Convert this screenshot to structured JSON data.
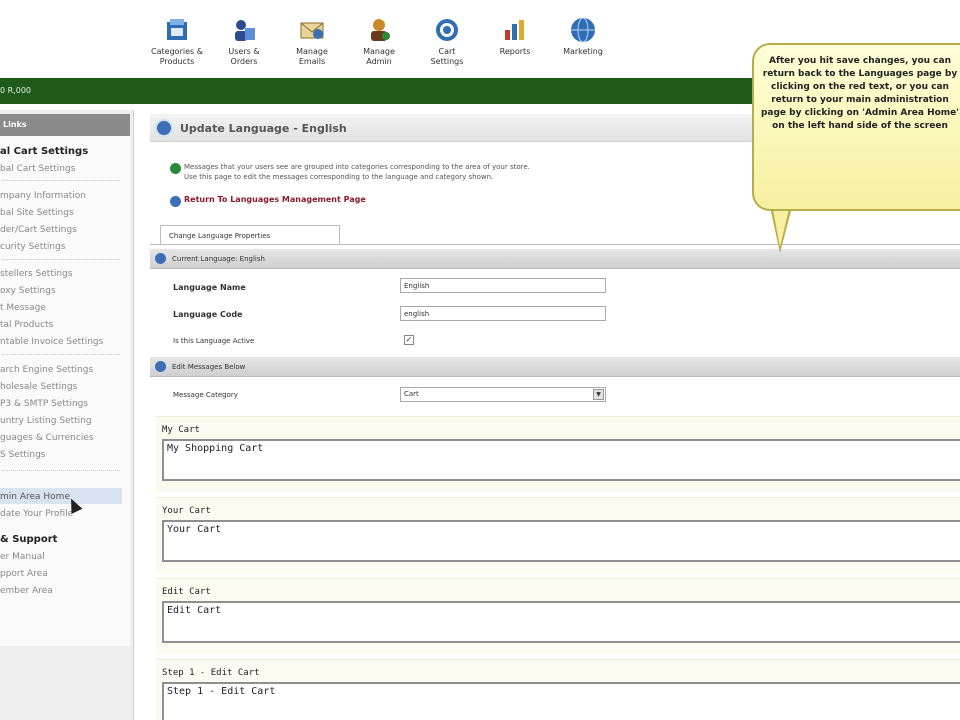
{
  "topnav": {
    "items": [
      {
        "label": "Categories &\nProducts",
        "icon": "categories-products-icon"
      },
      {
        "label": "Users &\nOrders",
        "icon": "users-orders-icon"
      },
      {
        "label": "Manage\nEmails",
        "icon": "manage-emails-icon"
      },
      {
        "label": "Manage\nAdmin",
        "icon": "manage-admin-icon"
      },
      {
        "label": "Cart\nSettings",
        "icon": "cart-settings-icon"
      },
      {
        "label": "Reports",
        "icon": "reports-icon"
      },
      {
        "label": "Marketing",
        "icon": "marketing-icon"
      }
    ]
  },
  "greenbar": {
    "text": "0 R,000"
  },
  "sidebar": {
    "heading": "Links",
    "cart_settings_title": "al Cart Settings",
    "cart_settings_items": [
      "bal Cart Settings",
      "mpany Information",
      "bal Site Settings",
      "der/Cart Settings",
      "curity Settings"
    ],
    "misc_items": [
      "stellers Settings",
      "oxy Settings",
      "t Message",
      "tal Products",
      "ntable Invoice Settings"
    ],
    "engine_items": [
      "arch Engine Settings",
      "holesale Settings",
      "P3 & SMTP Settings",
      "untry Listing Setting",
      "guages & Currencies",
      "S Settings"
    ],
    "admin_items": [
      "min Area Home",
      "date Your Profile"
    ],
    "support_title": "& Support",
    "support_items": [
      "er Manual",
      "pport Area",
      "ember Area"
    ]
  },
  "main": {
    "title": "Update Language - English",
    "info_lines": [
      "Messages that your users see are grouped into categories corresponding to the area of your store.",
      "Use this page to edit the messages corresponding to the language and category shown."
    ],
    "return_link": "Return To Languages Management Page",
    "tab_label": "Change Language Properties",
    "current_language_bar": "Current Language: English",
    "language_name_label": "Language Name",
    "language_name_value": "English",
    "language_code_label": "Language Code",
    "language_code_value": "english",
    "active_label": "Is this Language Active",
    "active_checked": true,
    "edit_messages_bar": "Edit Messages Below",
    "message_category_label": "Message Category",
    "message_category_value": "Cart",
    "messages": [
      {
        "label": "My Cart",
        "value": "My Shopping Cart"
      },
      {
        "label": "Your Cart",
        "value": "Your Cart"
      },
      {
        "label": "Edit Cart",
        "value": "Edit Cart"
      },
      {
        "label": "Step 1 - Edit Cart",
        "value": "Step 1 - Edit Cart"
      }
    ]
  },
  "callout": {
    "text": "After you hit save changes, you can return back to the Languages page by clicking on the red text, or you can return to your main administration page by clicking on 'Admin Area Home' on the left hand side of the screen"
  },
  "colors": {
    "green_bar": "#1f5a1a",
    "link_red": "#8a1c2e",
    "callout_yellow": "#f6f0a0"
  }
}
